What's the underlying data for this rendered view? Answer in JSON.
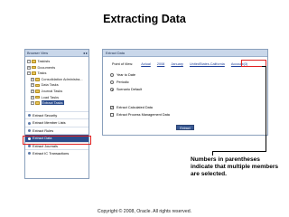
{
  "slide": {
    "title": "Extracting Data",
    "footer": "Copyright © 2008, Oracle. All rights reserved."
  },
  "browser": {
    "header": "Browser View",
    "tree": [
      {
        "label": "Taskists",
        "level": 0,
        "expander": "−"
      },
      {
        "label": "Documents",
        "level": 0,
        "expander": "+"
      },
      {
        "label": "Tasks",
        "level": 0,
        "expander": "−"
      },
      {
        "label": "Consolidation Administra...",
        "level": 1,
        "expander": "+"
      },
      {
        "label": "Data Tasks",
        "level": 1,
        "expander": "+"
      },
      {
        "label": "Journal Tasks",
        "level": 1,
        "expander": "+"
      },
      {
        "label": "Load Tasks",
        "level": 1,
        "expander": "+"
      },
      {
        "label": "Extract Tasks",
        "level": 1,
        "expander": "−",
        "selected": true
      }
    ],
    "tasks": [
      {
        "label": "Extract Security"
      },
      {
        "label": "Extract Member Lists"
      },
      {
        "label": "Extract Rules"
      },
      {
        "label": "Extract Data",
        "active": true
      },
      {
        "label": "Extract Journals"
      },
      {
        "label": "Extract IC Transactions"
      }
    ]
  },
  "extract": {
    "header": "Extract Data",
    "pov_label": "Point of View:",
    "pov_members": [
      "Actual",
      "2008",
      "January",
      "UnitedStates.California",
      "Account(3)"
    ],
    "options": [
      {
        "label": "Year to Date",
        "selected": false
      },
      {
        "label": "Periodic",
        "selected": false
      },
      {
        "label": "Scenario Default",
        "selected": true
      }
    ],
    "checkboxes": [
      {
        "label": "Extract Calculated Data",
        "checked": true
      },
      {
        "label": "Extract Process Management Data",
        "checked": false
      }
    ],
    "button": "Extract"
  },
  "callout": {
    "text": "Numbers in parentheses indicate that multiple members are selected."
  },
  "colors": {
    "highlight": "#e02020",
    "selected_row": "#2b4c8c",
    "panel_header": "#c9d7ea"
  }
}
